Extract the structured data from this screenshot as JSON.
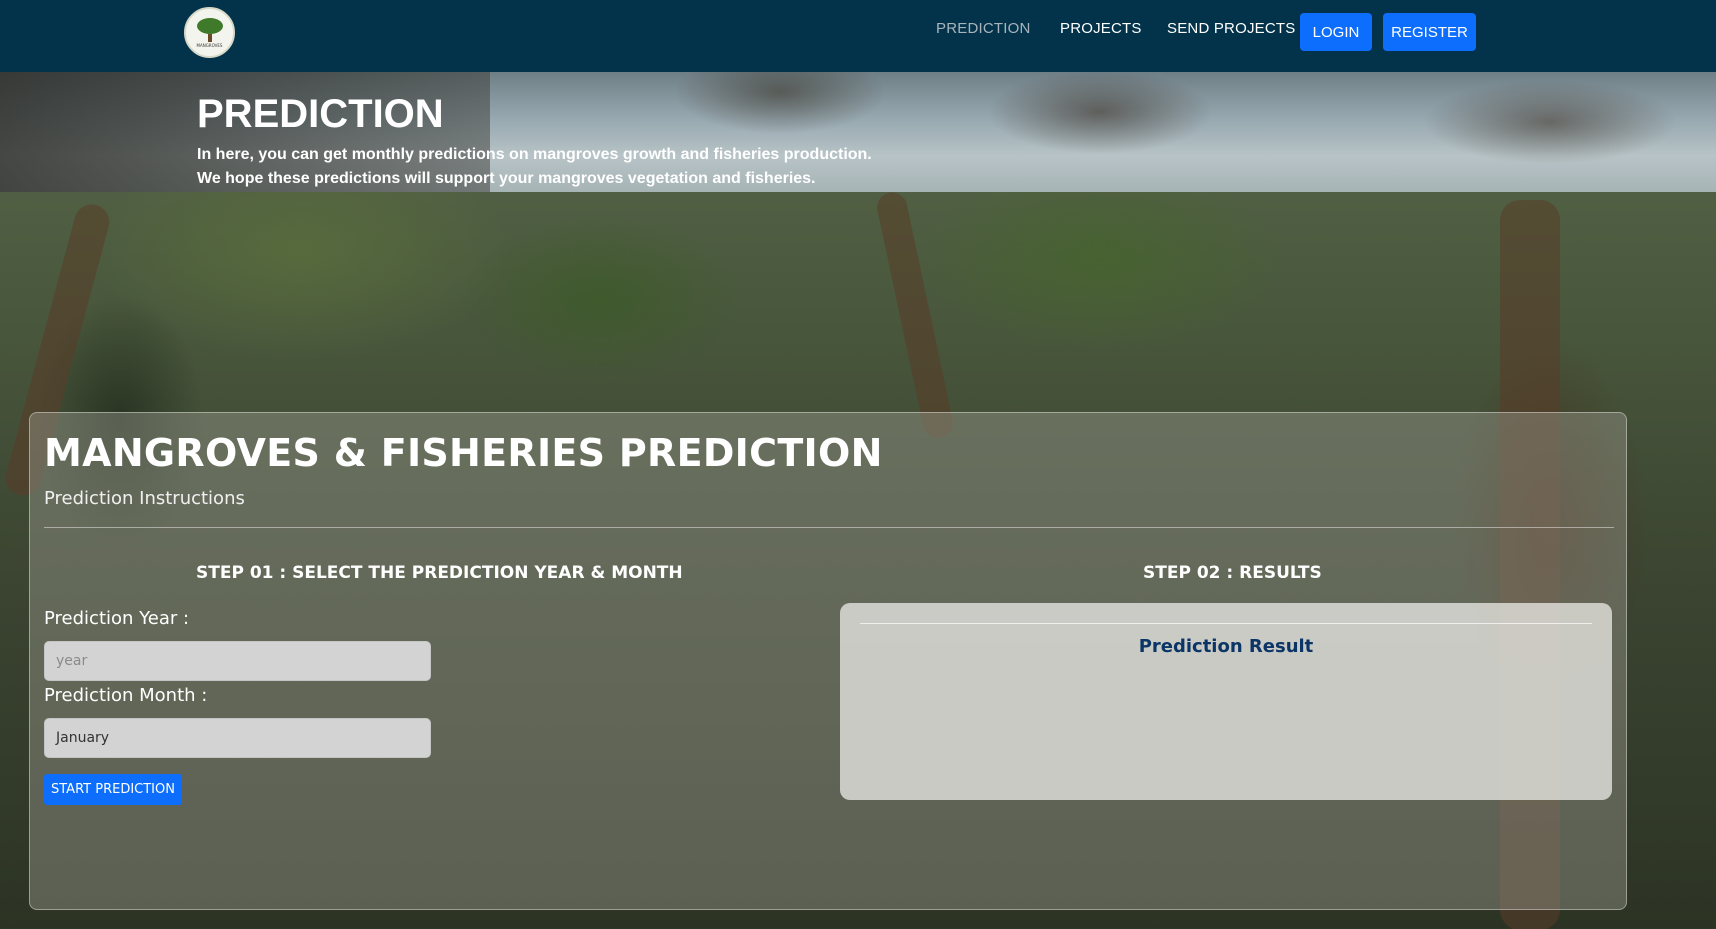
{
  "nav": {
    "logo_text": "MANGROVES",
    "links": [
      "PREDICTION",
      "PROJECTS",
      "SEND PROJECTS"
    ],
    "login_label": "LOGIN",
    "register_label": "REGISTER"
  },
  "hero": {
    "title": "PREDICTION",
    "line1": "In here, you can get monthly predictions on mangroves growth and fisheries production.",
    "line2": "We hope these predictions will support your mangroves vegetation and fisheries."
  },
  "card": {
    "title": "MANGROVES & FISHERIES PREDICTION",
    "subtitle": "Prediction Instructions",
    "step1": "STEP 01 : SELECT THE PREDICTION YEAR & MONTH",
    "step2": "STEP 02 : RESULTS",
    "year_label": "Prediction Year :",
    "year_placeholder": "year",
    "month_label": "Prediction Month :",
    "month_value": "January",
    "start_label": "START PREDICTION",
    "result_title": "Prediction Result"
  },
  "colors": {
    "navbar": "#03334a",
    "primary_button": "#0d6efd",
    "result_title": "#0b3566"
  }
}
